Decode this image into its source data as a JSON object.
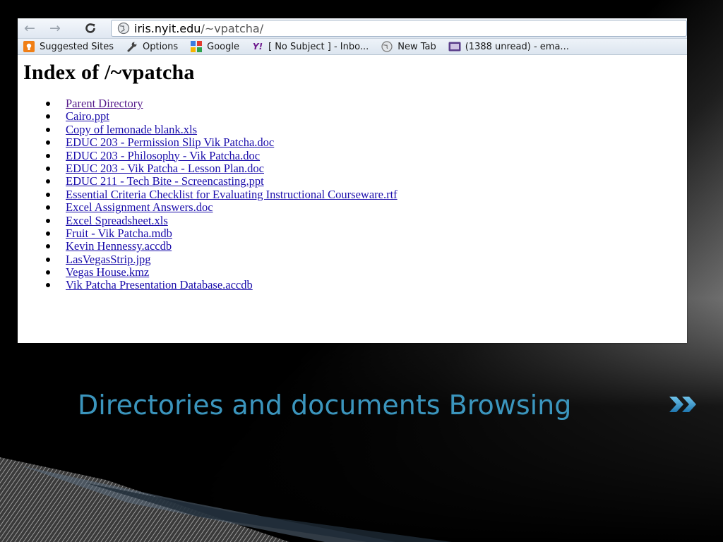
{
  "browser": {
    "nav": {
      "back_glyph": "←",
      "forward_glyph": "→",
      "reload_glyph": "C"
    },
    "address": {
      "host": "iris.nyit.edu",
      "path": "/~vpatcha/"
    },
    "bookmarks": [
      {
        "label": "Suggested Sites",
        "icon": "suggested-sites-icon",
        "color": "#f07f16"
      },
      {
        "label": "Options",
        "icon": "wrench-icon",
        "color": "#444444"
      },
      {
        "label": "Google",
        "icon": "google-icon",
        "color": "#3b7be0"
      },
      {
        "label": "[ No Subject ] - Inbo...",
        "icon": "yahoo-icon",
        "icon_text": "Y!",
        "color": "#6e1a8f"
      },
      {
        "label": "New Tab",
        "icon": "globe-icon",
        "color": "#777777"
      },
      {
        "label": "(1388 unread) - ema...",
        "icon": "mail-icon",
        "color": "#5a3d8a"
      }
    ]
  },
  "page": {
    "title": "Index of /~vpatcha",
    "files": [
      {
        "name": "Parent Directory",
        "visited": true
      },
      {
        "name": "Cairo.ppt"
      },
      {
        "name": "Copy of lemonade blank.xls"
      },
      {
        "name": "EDUC 203 - Permission Slip Vik Patcha.doc"
      },
      {
        "name": "EDUC 203 - Philosophy - Vik Patcha.doc"
      },
      {
        "name": "EDUC 203 - Vik Patcha - Lesson Plan.doc"
      },
      {
        "name": "EDUC 211 - Tech Bite - Screencasting.ppt"
      },
      {
        "name": "Essential Criteria Checklist for Evaluating Instructional Courseware.rtf"
      },
      {
        "name": "Excel Assignment Answers.doc"
      },
      {
        "name": "Excel Spreadsheet.xls"
      },
      {
        "name": "Fruit - Vik Patcha.mdb"
      },
      {
        "name": "Kevin Hennessy.accdb"
      },
      {
        "name": "LasVegasStrip.jpg"
      },
      {
        "name": "Vegas House.kmz"
      },
      {
        "name": "Vik Patcha Presentation Database.accdb"
      }
    ]
  },
  "slide": {
    "title": "Directories and documents Browsing",
    "title_color": "#3b95bd",
    "arrow_icon": "double-chevron-right-icon",
    "arrow_color": "#2f8fc4"
  }
}
